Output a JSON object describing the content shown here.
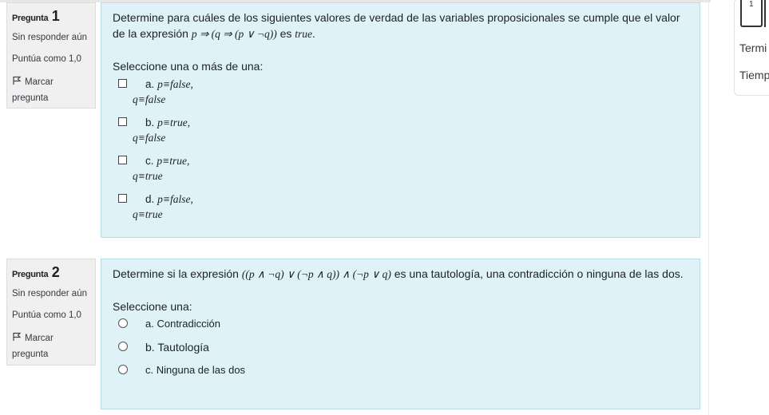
{
  "questions": [
    {
      "label": "Pregunta",
      "number": "1",
      "status": "Sin responder aún",
      "score": "Puntúa como 1,0",
      "flag_label": "Marcar pregunta",
      "text_pre": "Determine para cuáles de los siguientes valores de verdad de las variables proposicionales se cumple que el valor de la expresión ",
      "text_math": "p ⇒ (q ⇒ (p ∨ ¬q))",
      "text_mid": " es ",
      "text_math2": "true",
      "text_post": ".",
      "prompt": "Seleccione una o más de una:",
      "options": [
        {
          "letter": "a.",
          "line1": "p≡false,",
          "line2": "q≡false"
        },
        {
          "letter": "b.",
          "line1": "p≡true,",
          "line2": "q≡false"
        },
        {
          "letter": "c.",
          "line1": "p≡true,",
          "line2": "q≡true"
        },
        {
          "letter": "d.",
          "line1": "p≡false,",
          "line2": "q≡true"
        }
      ]
    },
    {
      "label": "Pregunta",
      "number": "2",
      "status": "Sin responder aún",
      "score": "Puntúa como 1,0",
      "flag_label": "Marcar pregunta",
      "text_pre": "Determine si la expresión ",
      "text_math": "((p ∧ ¬q) ∨ (¬p ∧ q)) ∧ (¬p ∨ q)",
      "text_post": " es una tautología, una contradicción o ninguna de las dos.",
      "prompt": "Seleccione una:",
      "options": [
        {
          "letter": "a.",
          "label": "Contradicción"
        },
        {
          "letter": "b.",
          "label": "Tautología"
        },
        {
          "letter": "c.",
          "label": "Ninguna de las dos"
        }
      ]
    }
  ],
  "sidebar": {
    "nav_number": "1",
    "finish_text": "Termi",
    "time_text": "Tiemp"
  }
}
